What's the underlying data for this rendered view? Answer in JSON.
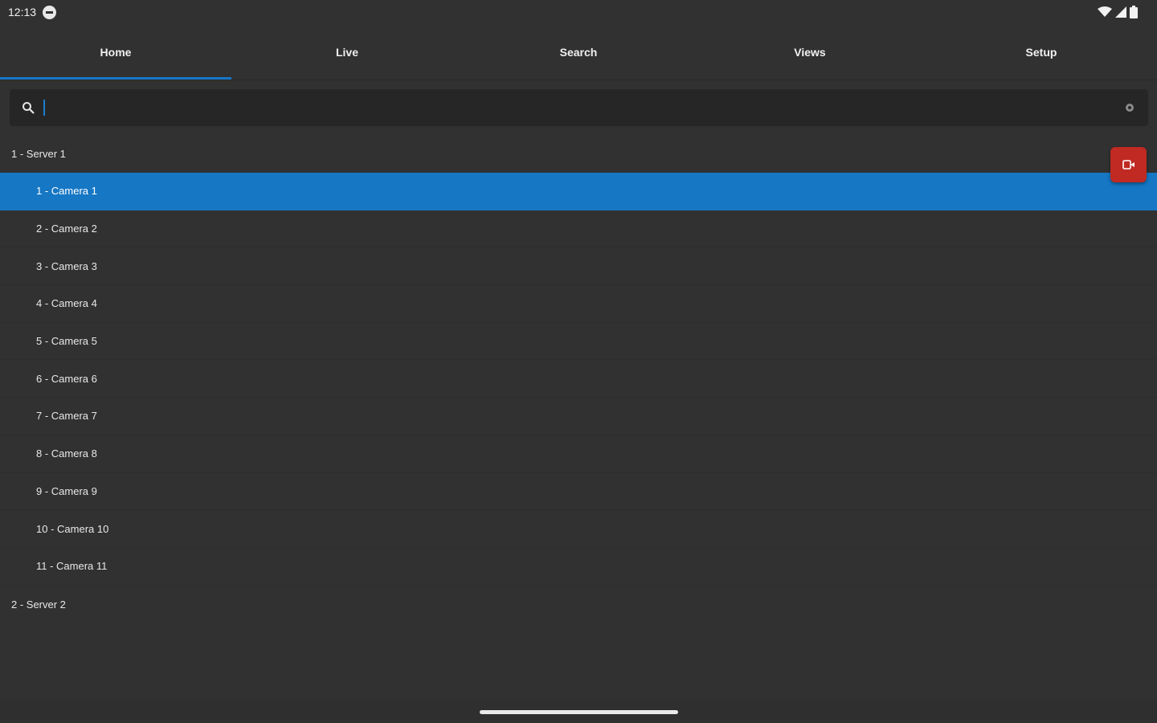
{
  "status": {
    "time": "12:13",
    "left_icon": "app-notification-icon",
    "right_icons": [
      "wifi-icon",
      "signal-icon",
      "battery-icon"
    ]
  },
  "tabs": [
    {
      "label": "Home",
      "active": true
    },
    {
      "label": "Live",
      "active": false
    },
    {
      "label": "Search",
      "active": false
    },
    {
      "label": "Views",
      "active": false
    },
    {
      "label": "Setup",
      "active": false
    }
  ],
  "search": {
    "value": "",
    "placeholder": ""
  },
  "servers": [
    {
      "label": "1 - Server 1",
      "cameras": [
        {
          "label": "1 - Camera 1",
          "selected": true
        },
        {
          "label": "2 - Camera 2"
        },
        {
          "label": "3 - Camera 3"
        },
        {
          "label": "4 - Camera 4"
        },
        {
          "label": "5 - Camera 5"
        },
        {
          "label": "6 - Camera 6"
        },
        {
          "label": "7 - Camera 7"
        },
        {
          "label": "8 - Camera 8"
        },
        {
          "label": "9 - Camera 9"
        },
        {
          "label": "10 - Camera 10"
        },
        {
          "label": "11 - Camera 11"
        }
      ]
    },
    {
      "label": "2 - Server 2",
      "cameras": []
    }
  ],
  "colors": {
    "accent": "#1677c4",
    "fab": "#c02a22",
    "background": "#313131"
  }
}
